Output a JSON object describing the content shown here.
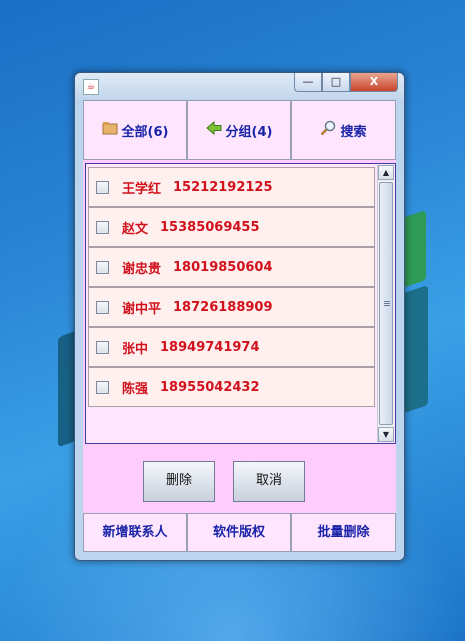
{
  "window": {
    "controls": {
      "minimize": "—",
      "maximize": "□",
      "close": "X"
    },
    "app_icon": "java-cup-icon"
  },
  "tabs": [
    {
      "label": "全部(6)",
      "icon": "folder-icon"
    },
    {
      "label": "分组(4)",
      "icon": "arrow-left-icon"
    },
    {
      "label": "搜索",
      "icon": "magnifier-icon"
    }
  ],
  "contacts": [
    {
      "name": "王学红",
      "phone": "15212192125"
    },
    {
      "name": "赵文",
      "phone": "15385069455"
    },
    {
      "name": "谢忠贵",
      "phone": "18019850604"
    },
    {
      "name": "谢中平",
      "phone": "18726188909"
    },
    {
      "name": "张中",
      "phone": "18949741974"
    },
    {
      "name": "陈强",
      "phone": "18955042432"
    }
  ],
  "actions": {
    "delete": "删除",
    "cancel": "取消"
  },
  "bottom_tabs": [
    "新增联系人",
    "软件版权",
    "批量删除"
  ],
  "colors": {
    "panel_bg": "#ffcdfd",
    "tab_text": "#1a24a8",
    "contact_text": "#d1111b"
  }
}
